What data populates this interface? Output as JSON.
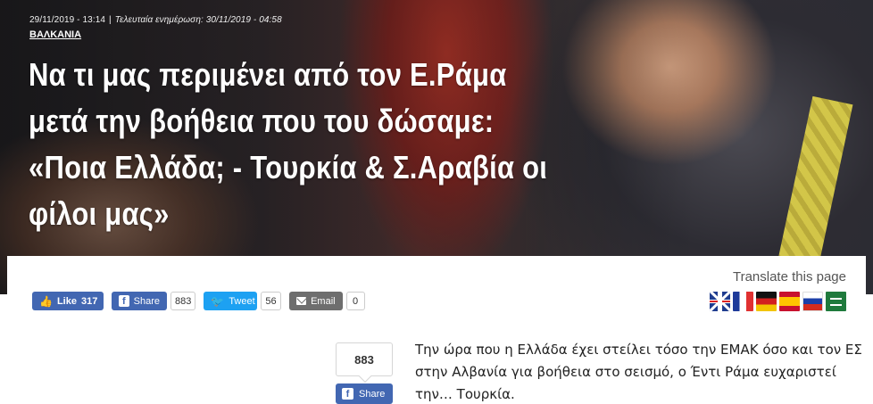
{
  "article": {
    "published": "29/11/2019 - 13:14",
    "separator": "|",
    "updated": "Τελευταία ενημέρωση: 30/11/2019 - 04:58",
    "category": "ΒΑΛΚΑΝΙΑ",
    "headline": "Να τι μας περιμένει από τον Ε.Ράμα μετά την βοήθεια που του δώσαμε: «Ποια Ελλάδα; - Τουρκία & Σ.Αραβία οι φίλοι μας»",
    "body": "Την ώρα που η Ελλάδα έχει στείλει τόσο την ΕΜΑΚ όσο και τον ΕΣ στην Αλβανία για βοήθεια στο σεισμό, ο Έντι Ράμα ευχαριστεί την… Τουρκία."
  },
  "share_bar": {
    "like_label": "Like",
    "like_count": "317",
    "facebook_label": "Share",
    "facebook_count": "883",
    "tweet_label": "Tweet",
    "tweet_count": "56",
    "email_label": "Email",
    "email_count": "0"
  },
  "side_share": {
    "count": "883",
    "label": "Share"
  },
  "translate": {
    "title": "Translate this page",
    "flags": [
      "uk-flag",
      "france-flag",
      "germany-flag",
      "spain-flag",
      "russia-flag",
      "saudi-arabia-flag"
    ]
  },
  "colors": {
    "facebook": "#4267b2",
    "twitter": "#1da1f2",
    "email": "#6e6e6e"
  }
}
